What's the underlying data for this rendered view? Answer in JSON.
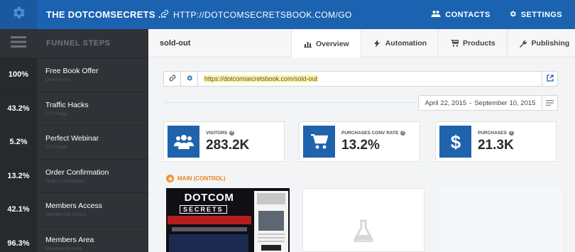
{
  "header": {
    "brand": "THE DOTCOMSECRETS ...",
    "site_url": "HTTP://DOTCOMSECRETSBOOK.COM/GO",
    "contacts": "CONTACTS",
    "settings": "SETTINGS"
  },
  "sidebar": {
    "title": "FUNNEL STEPS",
    "steps": [
      {
        "pct": "100%",
        "name": "Free Book Offer",
        "sub": "Order Form"
      },
      {
        "pct": "43.2%",
        "name": "Traffic Hacks",
        "sub": "OTO Page"
      },
      {
        "pct": "5.2%",
        "name": "Perfect Webinar",
        "sub": "OTO Page"
      },
      {
        "pct": "13.2%",
        "name": "Order Confirmation",
        "sub": "Order Confirmation"
      },
      {
        "pct": "42.1%",
        "name": "Members Access",
        "sub": "Membership Access"
      },
      {
        "pct": "96.3%",
        "name": "Members Area",
        "sub": "Membership Area"
      }
    ]
  },
  "main": {
    "page_title": "sold-out",
    "tabs": [
      {
        "label": "Overview",
        "icon": "bar-chart-icon",
        "active": true
      },
      {
        "label": "Automation",
        "icon": "bolt-icon",
        "active": false
      },
      {
        "label": "Products",
        "icon": "cart-icon",
        "active": false
      },
      {
        "label": "Publishing",
        "icon": "wrench-icon",
        "active": false
      }
    ],
    "page_url": "https://dotcomsecretsbook.com/sold-out",
    "date_start": "April 22, 2015",
    "date_sep": "-",
    "date_end": "September 10, 2015",
    "stats": [
      {
        "label": "VISITORS",
        "value": "283.2K",
        "icon": "users-icon"
      },
      {
        "label": "PURCHASES CONV RATE",
        "value": "13.2%",
        "icon": "cart-icon"
      },
      {
        "label": "PURCHASES",
        "value": "21.3K",
        "icon": "dollar-icon"
      }
    ],
    "help_glyph": "?",
    "variant_label": "MAIN (CONTROL)",
    "thumbnail": {
      "title": "DOTCOM",
      "subtitle": "SECRETS"
    }
  },
  "colors": {
    "accent": "#1b63b0",
    "sidebar": "#2f3337",
    "variant": "#f39324",
    "url_highlight": "#fdf39c"
  }
}
